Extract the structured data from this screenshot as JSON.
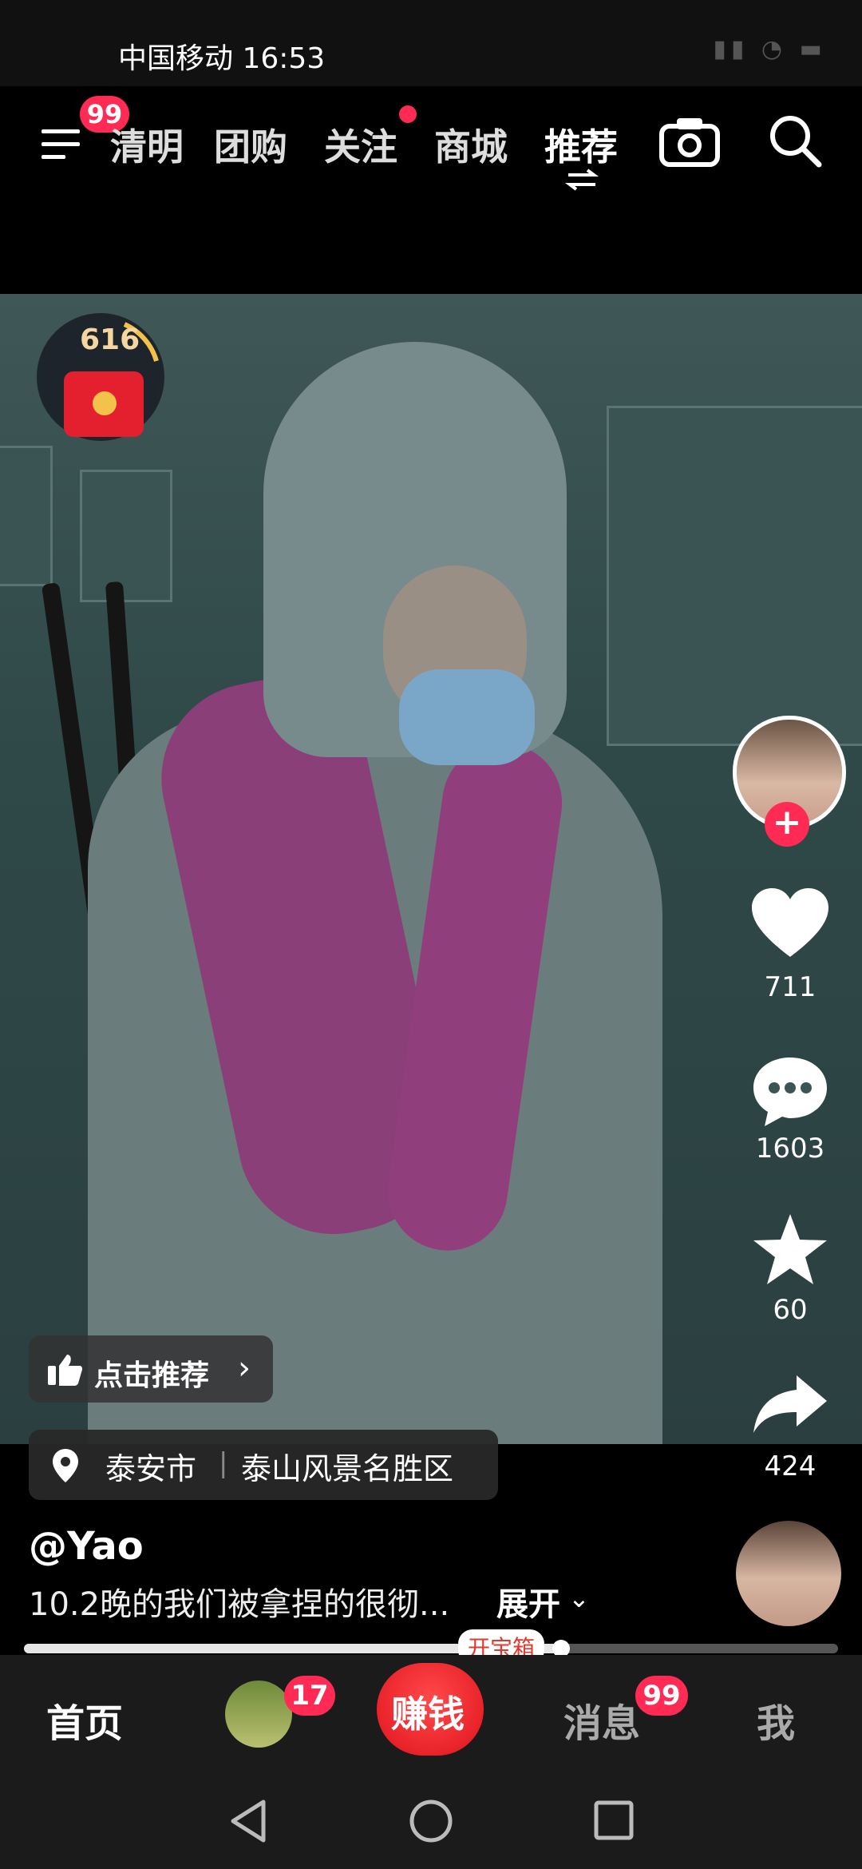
{
  "status_bar": {
    "carrier_time": "中国移动 16:53"
  },
  "top_nav": {
    "menu_badge": "99",
    "tabs": [
      {
        "label": "清明"
      },
      {
        "label": "团购"
      },
      {
        "label": "关注"
      },
      {
        "label": "商城"
      },
      {
        "label": "推荐"
      }
    ]
  },
  "red_packet": {
    "count": "616"
  },
  "actions": {
    "likes": "711",
    "comments": "1603",
    "favorites": "60",
    "shares": "424"
  },
  "recommend": {
    "label": "点击推荐"
  },
  "location": {
    "city": "泰安市",
    "separator": "|",
    "place": "泰山风景名胜区"
  },
  "caption": {
    "user": "@Yao",
    "text": "10.2晚的我们被拿捏的很彻...",
    "expand": "展开"
  },
  "progress": {
    "fraction": 0.66,
    "treasure_label": "开宝箱"
  },
  "bottom_tabs": {
    "home": "首页",
    "friends_badge": "17",
    "earn": "赚钱",
    "messages": "消息",
    "messages_badge": "99",
    "me": "我"
  },
  "colors": {
    "accent": "#ff2b55",
    "earn": "#e0121d"
  }
}
